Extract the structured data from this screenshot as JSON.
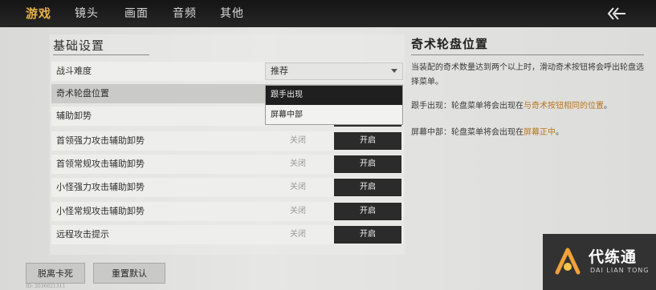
{
  "tabs": [
    {
      "label": "游戏",
      "active": true
    },
    {
      "label": "镜头"
    },
    {
      "label": "画面"
    },
    {
      "label": "音频"
    },
    {
      "label": "其他"
    }
  ],
  "back_icon": "double-chevron-left-arrow-icon",
  "section_title": "基础设置",
  "rows": [
    {
      "label": "战斗难度"
    },
    {
      "label": "奇术轮盘位置"
    },
    {
      "label": "辅助卸势"
    },
    {
      "label": "首领强力攻击辅助卸势",
      "off": "关闭",
      "on": "开启"
    },
    {
      "label": "首领常规攻击辅助卸势",
      "off": "关闭",
      "on": "开启"
    },
    {
      "label": "小怪强力攻击辅助卸势",
      "off": "关闭",
      "on": "开启"
    },
    {
      "label": "小怪常规攻击辅助卸势",
      "off": "关闭",
      "on": "开启"
    },
    {
      "label": "远程攻击提示",
      "off": "关闭",
      "on": "开启"
    }
  ],
  "difficulty_dropdown": {
    "value": "推荐"
  },
  "wheel_menu": {
    "options": [
      "跟手出现",
      "屏幕中部"
    ]
  },
  "detail": {
    "title": "奇术轮盘位置",
    "desc": "当装配的奇术数量达到两个以上时，滑动奇术按钮将会呼出轮盘选择菜单。",
    "opt1_prefix": "跟手出现：",
    "opt1_text": "轮盘菜单将会出现在",
    "opt1_highlight": "与奇术按钮相同的位置",
    "opt1_suffix": "。",
    "opt2_prefix": "屏幕中部：",
    "opt2_text": "轮盘菜单将会出现在",
    "opt2_highlight": "屏幕正中",
    "opt2_suffix": "。"
  },
  "buttons": {
    "stuck": "脱离卡死",
    "reset": "重置默认"
  },
  "uid": "ID: 2036021311",
  "watermark": {
    "name": "代练通",
    "pinyin": "DAI LIAN TONG"
  },
  "colors": {
    "accent": "#e6b24a",
    "highlight": "#b5761f"
  }
}
